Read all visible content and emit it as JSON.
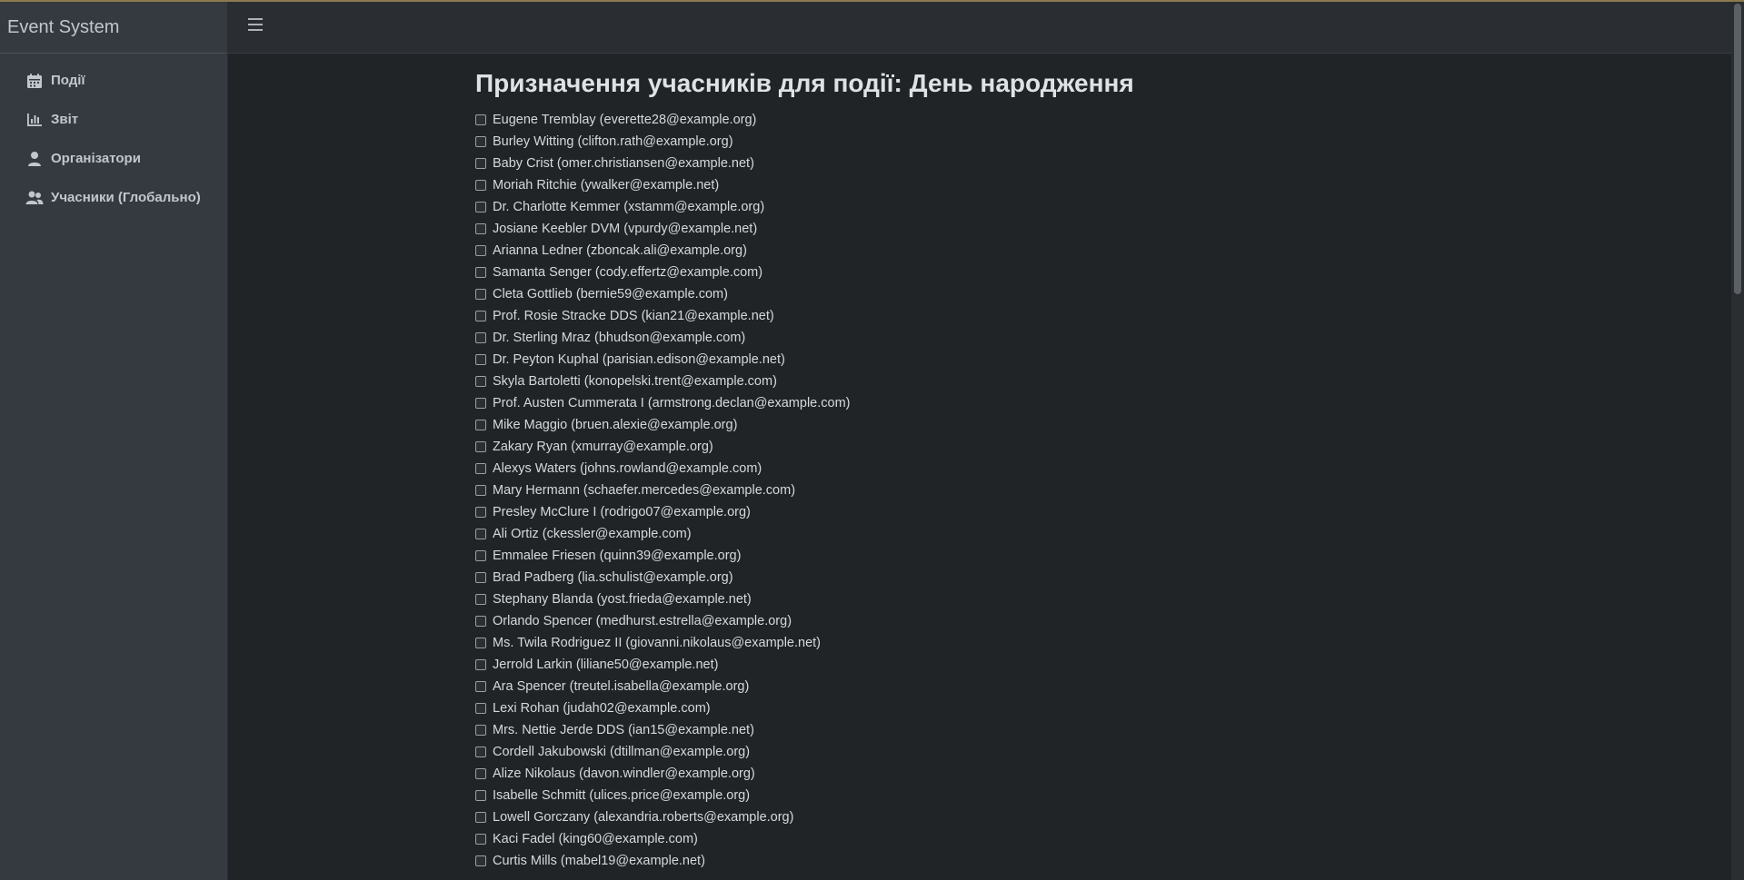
{
  "sidebar": {
    "brand": "Event System",
    "items": [
      {
        "label": "Події",
        "icon": "calendar-icon"
      },
      {
        "label": "Звіт",
        "icon": "bar-chart-icon"
      },
      {
        "label": "Організатори",
        "icon": "user-icon"
      },
      {
        "label": "Учасники (Глобально)",
        "icon": "users-icon"
      }
    ]
  },
  "page": {
    "title": "Призначення учасників для події: День народження"
  },
  "participants": [
    "Eugene Tremblay (everette28@example.org)",
    "Burley Witting (clifton.rath@example.org)",
    "Baby Crist (omer.christiansen@example.net)",
    "Moriah Ritchie (ywalker@example.net)",
    "Dr. Charlotte Kemmer (xstamm@example.org)",
    "Josiane Keebler DVM (vpurdy@example.net)",
    "Arianna Ledner (zboncak.ali@example.org)",
    "Samanta Senger (cody.effertz@example.com)",
    "Cleta Gottlieb (bernie59@example.com)",
    "Prof. Rosie Stracke DDS (kian21@example.net)",
    "Dr. Sterling Mraz (bhudson@example.com)",
    "Dr. Peyton Kuphal (parisian.edison@example.net)",
    "Skyla Bartoletti (konopelski.trent@example.com)",
    "Prof. Austen Cummerata I (armstrong.declan@example.com)",
    "Mike Maggio (bruen.alexie@example.org)",
    "Zakary Ryan (xmurray@example.org)",
    "Alexys Waters (johns.rowland@example.com)",
    "Mary Hermann (schaefer.mercedes@example.com)",
    "Presley McClure I (rodrigo07@example.org)",
    "Ali Ortiz (ckessler@example.com)",
    "Emmalee Friesen (quinn39@example.org)",
    "Brad Padberg (lia.schulist@example.org)",
    "Stephany Blanda (yost.frieda@example.net)",
    "Orlando Spencer (medhurst.estrella@example.org)",
    "Ms. Twila Rodriguez II (giovanni.nikolaus@example.net)",
    "Jerrold Larkin (liliane50@example.net)",
    "Ara Spencer (treutel.isabella@example.org)",
    "Lexi Rohan (judah02@example.com)",
    "Mrs. Nettie Jerde DDS (ian15@example.net)",
    "Cordell Jakubowski (dtillman@example.org)",
    "Alize Nikolaus (davon.windler@example.org)",
    "Isabelle Schmitt (ulices.price@example.org)",
    "Lowell Gorczany (alexandria.roberts@example.org)",
    "Kaci Fadel (king60@example.com)",
    "Curtis Mills (mabel19@example.net)"
  ]
}
